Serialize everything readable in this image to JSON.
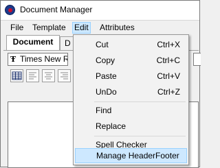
{
  "window": {
    "title": "Document Manager"
  },
  "menubar": {
    "items": [
      {
        "label": "File"
      },
      {
        "label": "Template"
      },
      {
        "label": "Edit"
      },
      {
        "label": "Attributes"
      }
    ]
  },
  "tabs": [
    {
      "label": "Document"
    },
    {
      "label": "D"
    }
  ],
  "toolbar": {
    "font_value": "Times New Roman"
  },
  "edit_menu": {
    "items": [
      {
        "label": "Cut",
        "shortcut": "Ctrl+X"
      },
      {
        "label": "Copy",
        "shortcut": "Ctrl+C"
      },
      {
        "label": "Paste",
        "shortcut": "Ctrl+V"
      },
      {
        "label": "UnDo",
        "shortcut": "Ctrl+Z"
      },
      {
        "label": "Find",
        "shortcut": ""
      },
      {
        "label": "Replace",
        "shortcut": ""
      },
      {
        "label": "Spell Checker",
        "shortcut": ""
      },
      {
        "label": "Manage HeaderFooter",
        "shortcut": ""
      }
    ]
  },
  "colors": {
    "menu_highlight": "#cce8ff",
    "menu_highlight_border": "#99d1ff"
  }
}
